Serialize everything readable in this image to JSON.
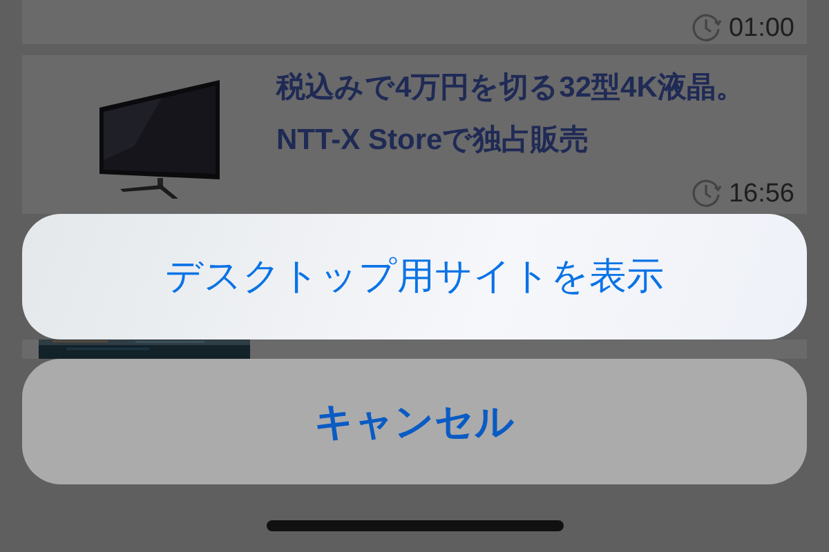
{
  "articles": [
    {
      "time": "01:00"
    },
    {
      "thumbnail": {
        "kind": "picture"
      },
      "title": "税込みで4万円を切る32型4K液晶。NTT-X Storeで独占販売",
      "time": "16:56"
    },
    {
      "thumbnail": {
        "kind": "picture"
      }
    }
  ],
  "action_sheet": {
    "actions": [
      "デスクトップ用サイトを表示"
    ],
    "cancel": "キャンセル"
  }
}
